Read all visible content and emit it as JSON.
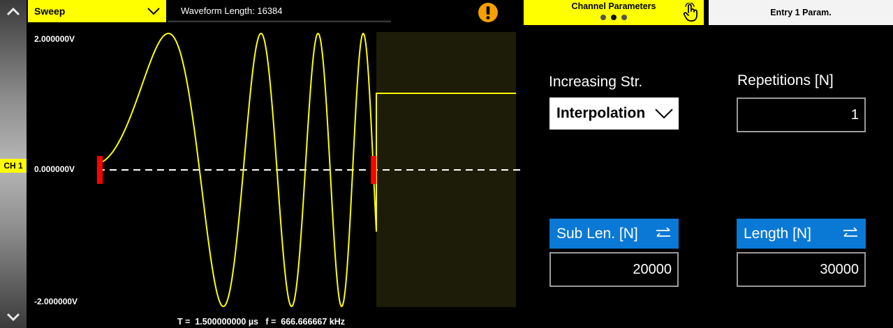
{
  "channel_tag": "CH 1",
  "waveform_select": {
    "value": "Sweep"
  },
  "waveform_length": "Waveform Length:  16384",
  "tabs": {
    "channel_parameters": "Channel Parameters",
    "entry_param": "Entry  1  Param."
  },
  "plot": {
    "y_top": "2.000000V",
    "y_mid": "0.000000V",
    "y_bottom": "-2.000000V",
    "period_freq": "T =  1.500000000 µs   f =  666.666667 kHz",
    "trace_color": "#ffff00",
    "marker_color": "#ff0000",
    "shaded_color": "#1c1c08"
  },
  "params": {
    "increasing_label": "Increasing Str.",
    "increasing_value": "Interpolation",
    "repetitions_label": "Repetitions [N]",
    "repetitions_value": "1",
    "sublen_label": "Sub Len. [N]",
    "sublen_value": "20000",
    "length_label": "Length [N]",
    "length_value": "30000"
  },
  "icons": [
    "chevron-up-icon",
    "chevron-down-icon",
    "warning-icon",
    "hand-pointer-icon",
    "swap-icon"
  ],
  "colors": {
    "accent": "#ffff00",
    "button_blue": "#0a79d6",
    "warning": "#f5a000"
  }
}
